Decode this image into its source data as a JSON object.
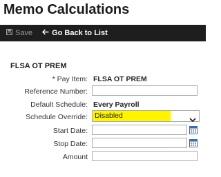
{
  "page": {
    "title": "Memo Calculations"
  },
  "toolbar": {
    "save_label": "Save",
    "back_label": "Go Back to List"
  },
  "form": {
    "section_title": "FLSA OT PREM",
    "pay_item": {
      "label": "* Pay Item:",
      "value": "FLSA OT PREM"
    },
    "reference_number": {
      "label": "Reference Number:",
      "value": ""
    },
    "default_schedule": {
      "label": "Default Schedule:",
      "value": "Every Payroll"
    },
    "schedule_override": {
      "label": "Schedule Override:",
      "value": "Disabled",
      "highlight_color": "#fff500"
    },
    "start_date": {
      "label": "Start Date:",
      "value": ""
    },
    "stop_date": {
      "label": "Stop Date:",
      "value": ""
    },
    "amount": {
      "label": "Amount",
      "value": ""
    }
  },
  "icons": {
    "save": "save-icon",
    "back": "arrow-left-icon",
    "dropdown": "chevron-down-icon",
    "calendar": "calendar-icon"
  },
  "colors": {
    "toolbar_bg": "#1e1e1e",
    "highlight": "#fff500",
    "calendar_accent": "#3a6ea5"
  }
}
